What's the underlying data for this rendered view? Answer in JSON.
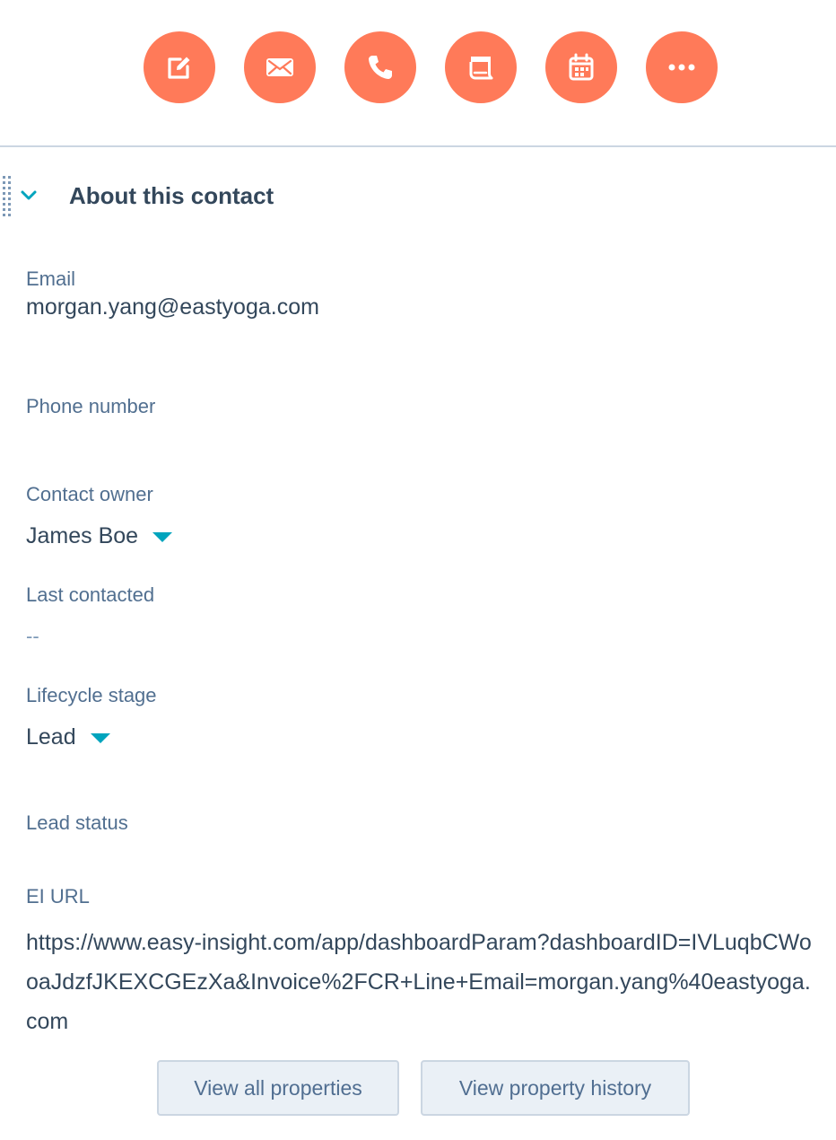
{
  "actions": [
    {
      "label": "Note",
      "icon": "note-pencil-icon"
    },
    {
      "label": "Email",
      "icon": "envelope-icon"
    },
    {
      "label": "Call",
      "icon": "phone-icon"
    },
    {
      "label": "Log",
      "icon": "log-activity-icon"
    },
    {
      "label": "Task",
      "icon": "calendar-task-icon"
    },
    {
      "label": "More",
      "icon": "more-dots-icon"
    }
  ],
  "colors": {
    "accent": "#ff7a59",
    "teal": "#00a4bd",
    "text": "#33475b",
    "label": "#516f90"
  },
  "section": {
    "title": "About this contact",
    "expanded": true
  },
  "properties": {
    "email": {
      "label": "Email",
      "value": "morgan.yang@eastyoga.com"
    },
    "phone": {
      "label": "Phone number",
      "value": ""
    },
    "owner": {
      "label": "Contact owner",
      "value": "James Boe"
    },
    "last_contacted": {
      "label": "Last contacted",
      "value": "--"
    },
    "lifecycle": {
      "label": "Lifecycle stage",
      "value": "Lead"
    },
    "lead_status": {
      "label": "Lead status",
      "value": ""
    },
    "ei_url": {
      "label": "EI URL",
      "value": "https://www.easy-insight.com/app/dashboardParam?dashboardID=IVLuqbCWooaJdzfJKEXCGEzXa&Invoice%2FCR+Line+Email=morgan.yang%40eastyoga.com"
    }
  },
  "buttons": {
    "view_all": "View all properties",
    "view_history": "View property history"
  }
}
